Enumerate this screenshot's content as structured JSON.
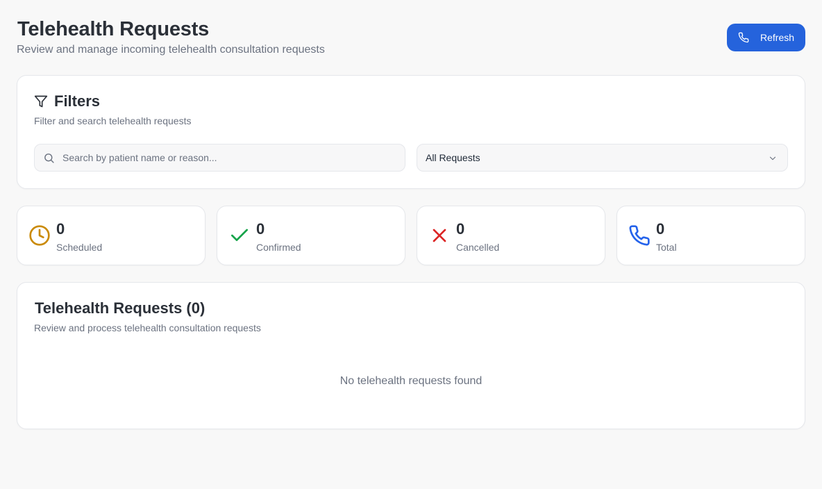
{
  "header": {
    "title": "Telehealth Requests",
    "subtitle": "Review and manage incoming telehealth consultation requests",
    "refresh_label": "Refresh"
  },
  "filters": {
    "title": "Filters",
    "subtitle": "Filter and search telehealth requests",
    "search_placeholder": "Search by patient name or reason...",
    "search_value": "",
    "status_selected": "All Requests"
  },
  "stats": [
    {
      "value": "0",
      "label": "Scheduled",
      "icon": "clock-icon",
      "color": "#ca8a04"
    },
    {
      "value": "0",
      "label": "Confirmed",
      "icon": "check-icon",
      "color": "#16a34a"
    },
    {
      "value": "0",
      "label": "Cancelled",
      "icon": "x-icon",
      "color": "#dc2626"
    },
    {
      "value": "0",
      "label": "Total",
      "icon": "phone-icon",
      "color": "#2563eb"
    }
  ],
  "requests": {
    "title": "Telehealth Requests (0)",
    "subtitle": "Review and process telehealth consultation requests",
    "empty_text": "No telehealth requests found"
  },
  "colors": {
    "accent": "#2563dc",
    "background": "#f8f8f8",
    "muted_text": "#6b7280"
  }
}
